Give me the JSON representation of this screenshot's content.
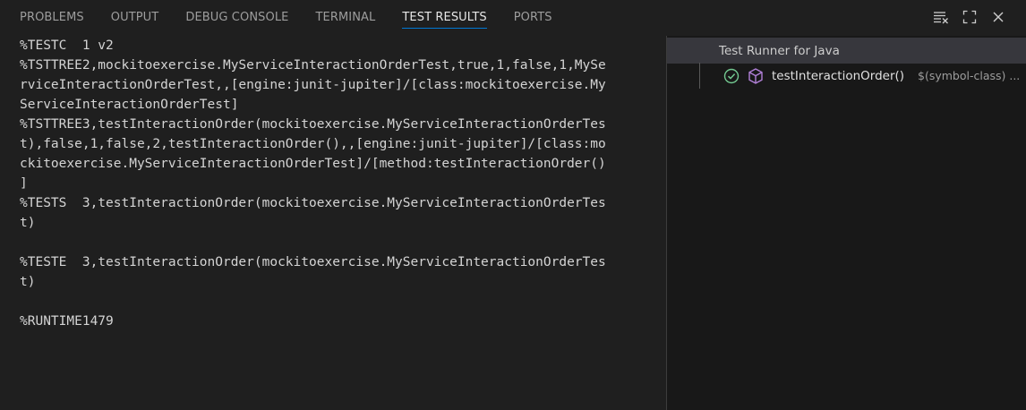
{
  "tabs": [
    {
      "label": "PROBLEMS"
    },
    {
      "label": "OUTPUT"
    },
    {
      "label": "DEBUG CONSOLE"
    },
    {
      "label": "TERMINAL"
    },
    {
      "label": "TEST RESULTS"
    },
    {
      "label": "PORTS"
    }
  ],
  "active_tab": "TEST RESULTS",
  "actions": [
    "clear-output-icon",
    "maximize-panel-icon",
    "close-icon"
  ],
  "output_lines": [
    "%TESTC  1 v2",
    "%TSTTREE2,mockitoexercise.MyServiceInteractionOrderTest,true,1,false,1,MySe",
    "rviceInteractionOrderTest,,[engine:junit-jupiter]/[class:mockitoexercise.My",
    "ServiceInteractionOrderTest]",
    "%TSTTREE3,testInteractionOrder(mockitoexercise.MyServiceInteractionOrderTes",
    "t),false,1,false,2,testInteractionOrder(),,[engine:junit-jupiter]/[class:mo",
    "ckitoexercise.MyServiceInteractionOrderTest]/[method:testInteractionOrder()",
    "]",
    "%TESTS  3,testInteractionOrder(mockitoexercise.MyServiceInteractionOrderTes",
    "t)",
    "",
    "%TESTE  3,testInteractionOrder(mockitoexercise.MyServiceInteractionOrderTes",
    "t)",
    "",
    "%RUNTIME1479"
  ],
  "tree": {
    "root_label": "Test Runner for Java",
    "child": {
      "label": "testInteractionOrder()",
      "description": "$(symbol-class) ...",
      "status": "passed"
    }
  },
  "colors": {
    "accent": "#0078d4",
    "passed": "#73c991",
    "class_icon": "#b180d7"
  }
}
